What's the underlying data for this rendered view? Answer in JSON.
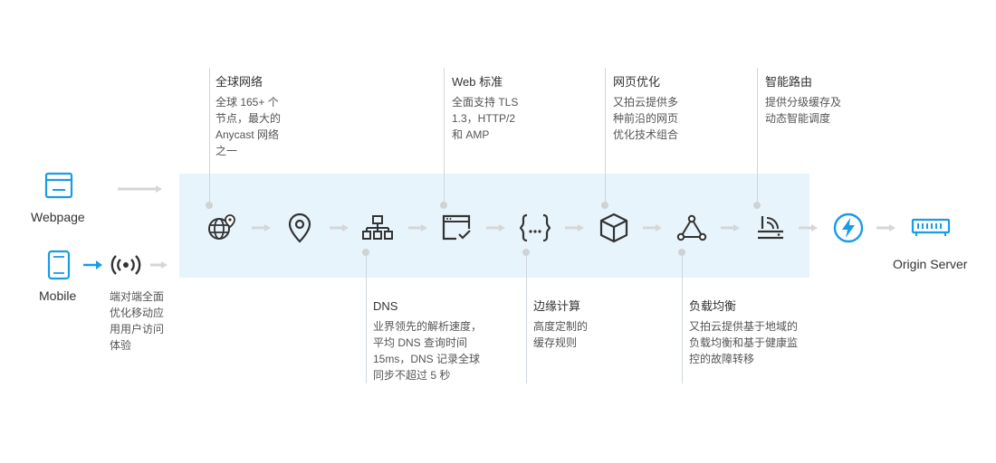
{
  "devices": {
    "webpage": "Webpage",
    "mobile": "Mobile",
    "mobile_note": "端对端全面\n优化移动应\n用用户访问\n体验"
  },
  "origin": "Origin Server",
  "top_features": [
    {
      "title": "全球网络",
      "desc": "全球 165+ 个\n节点，最大的\nAnycast 网络\n之一"
    },
    {
      "title": "Web 标准",
      "desc": "全面支持 TLS\n1.3，HTTP/2\n和 AMP"
    },
    {
      "title": "网页优化",
      "desc": "又拍云提供多\n种前沿的网页\n优化技术组合"
    },
    {
      "title": "智能路由",
      "desc": "提供分级缓存及\n动态智能调度"
    }
  ],
  "bottom_features": [
    {
      "title": "DNS",
      "desc": "业界领先的解析速度，\n平均 DNS 查询时间\n15ms，DNS 记录全球\n同步不超过 5 秒"
    },
    {
      "title": "边缘计算",
      "desc": "高度定制的\n缓存规则"
    },
    {
      "title": "负载均衡",
      "desc": "又拍云提供基于地域的\n负载均衡和基于健康监\n控的故障转移"
    }
  ],
  "colors": {
    "accent": "#1a9be6",
    "band": "#e8f4fc",
    "icon": "#333333",
    "arrow": "#d6d6d6"
  },
  "icons": [
    "globe-location-icon",
    "location-pin-icon",
    "network-tree-icon",
    "browser-check-icon",
    "code-braces-icon",
    "cube-icon",
    "triangle-nodes-icon",
    "router-icon",
    "lightning-icon",
    "server-icon"
  ]
}
